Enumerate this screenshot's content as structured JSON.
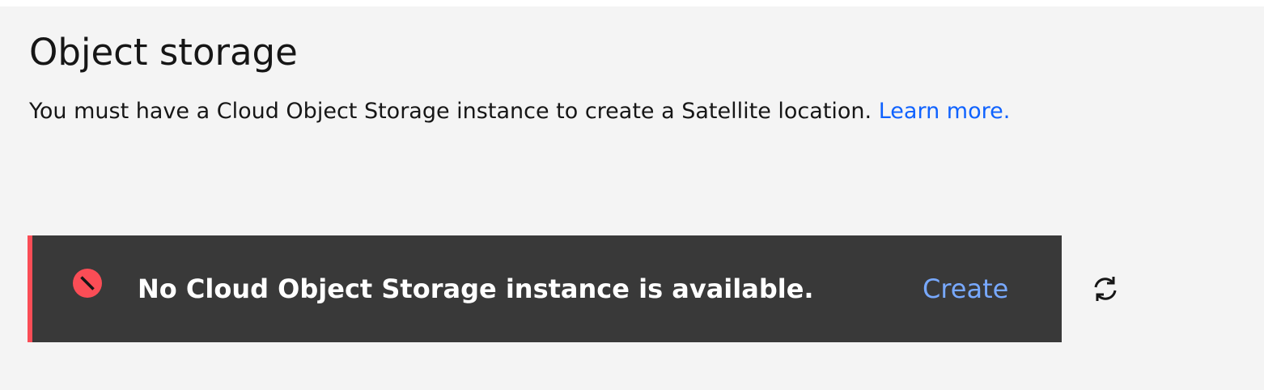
{
  "section": {
    "title": "Object storage",
    "description": "You must have a Cloud Object Storage instance to create a Satellite location.",
    "learn_more_label": "Learn more."
  },
  "notification": {
    "kind": "error",
    "icon": "error-icon",
    "message": "No Cloud Object Storage instance is available.",
    "action_label": "Create"
  },
  "refresh": {
    "icon": "refresh-icon"
  },
  "colors": {
    "background": "#f4f4f4",
    "notification_background": "#393939",
    "error_accent": "#fa4d56",
    "link": "#0f62fe",
    "inverse_link": "#78a9ff",
    "text": "#161616"
  }
}
